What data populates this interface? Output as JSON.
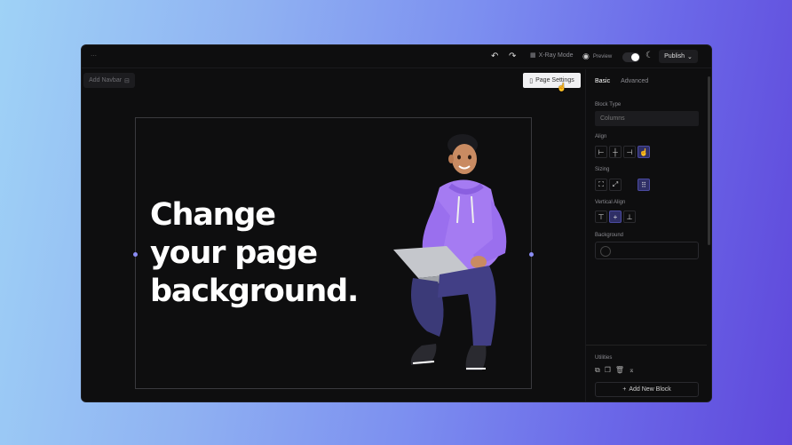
{
  "toolbar": {
    "xray_label": "X-Ray Mode",
    "preview_label": "Preview",
    "publish_label": "Publish",
    "add_navbar_label": "Add Navbar",
    "page_settings_label": "Page Settings"
  },
  "canvas": {
    "headline_lines": [
      "Change",
      "your page",
      "background."
    ]
  },
  "panel": {
    "tabs": [
      "Basic",
      "Advanced"
    ],
    "block_type_label": "Block Type",
    "block_type_value": "Columns",
    "align_label": "Align",
    "sizing_label": "Sizing",
    "vertical_align_label": "Vertical Align",
    "background_label": "Background",
    "utilities_label": "Utilities",
    "add_new_block_label": "Add New Block"
  },
  "colors": {
    "accent": "#8b8df5",
    "panel_bg": "#0e0e0f",
    "active_seg": "#2f2f66"
  }
}
